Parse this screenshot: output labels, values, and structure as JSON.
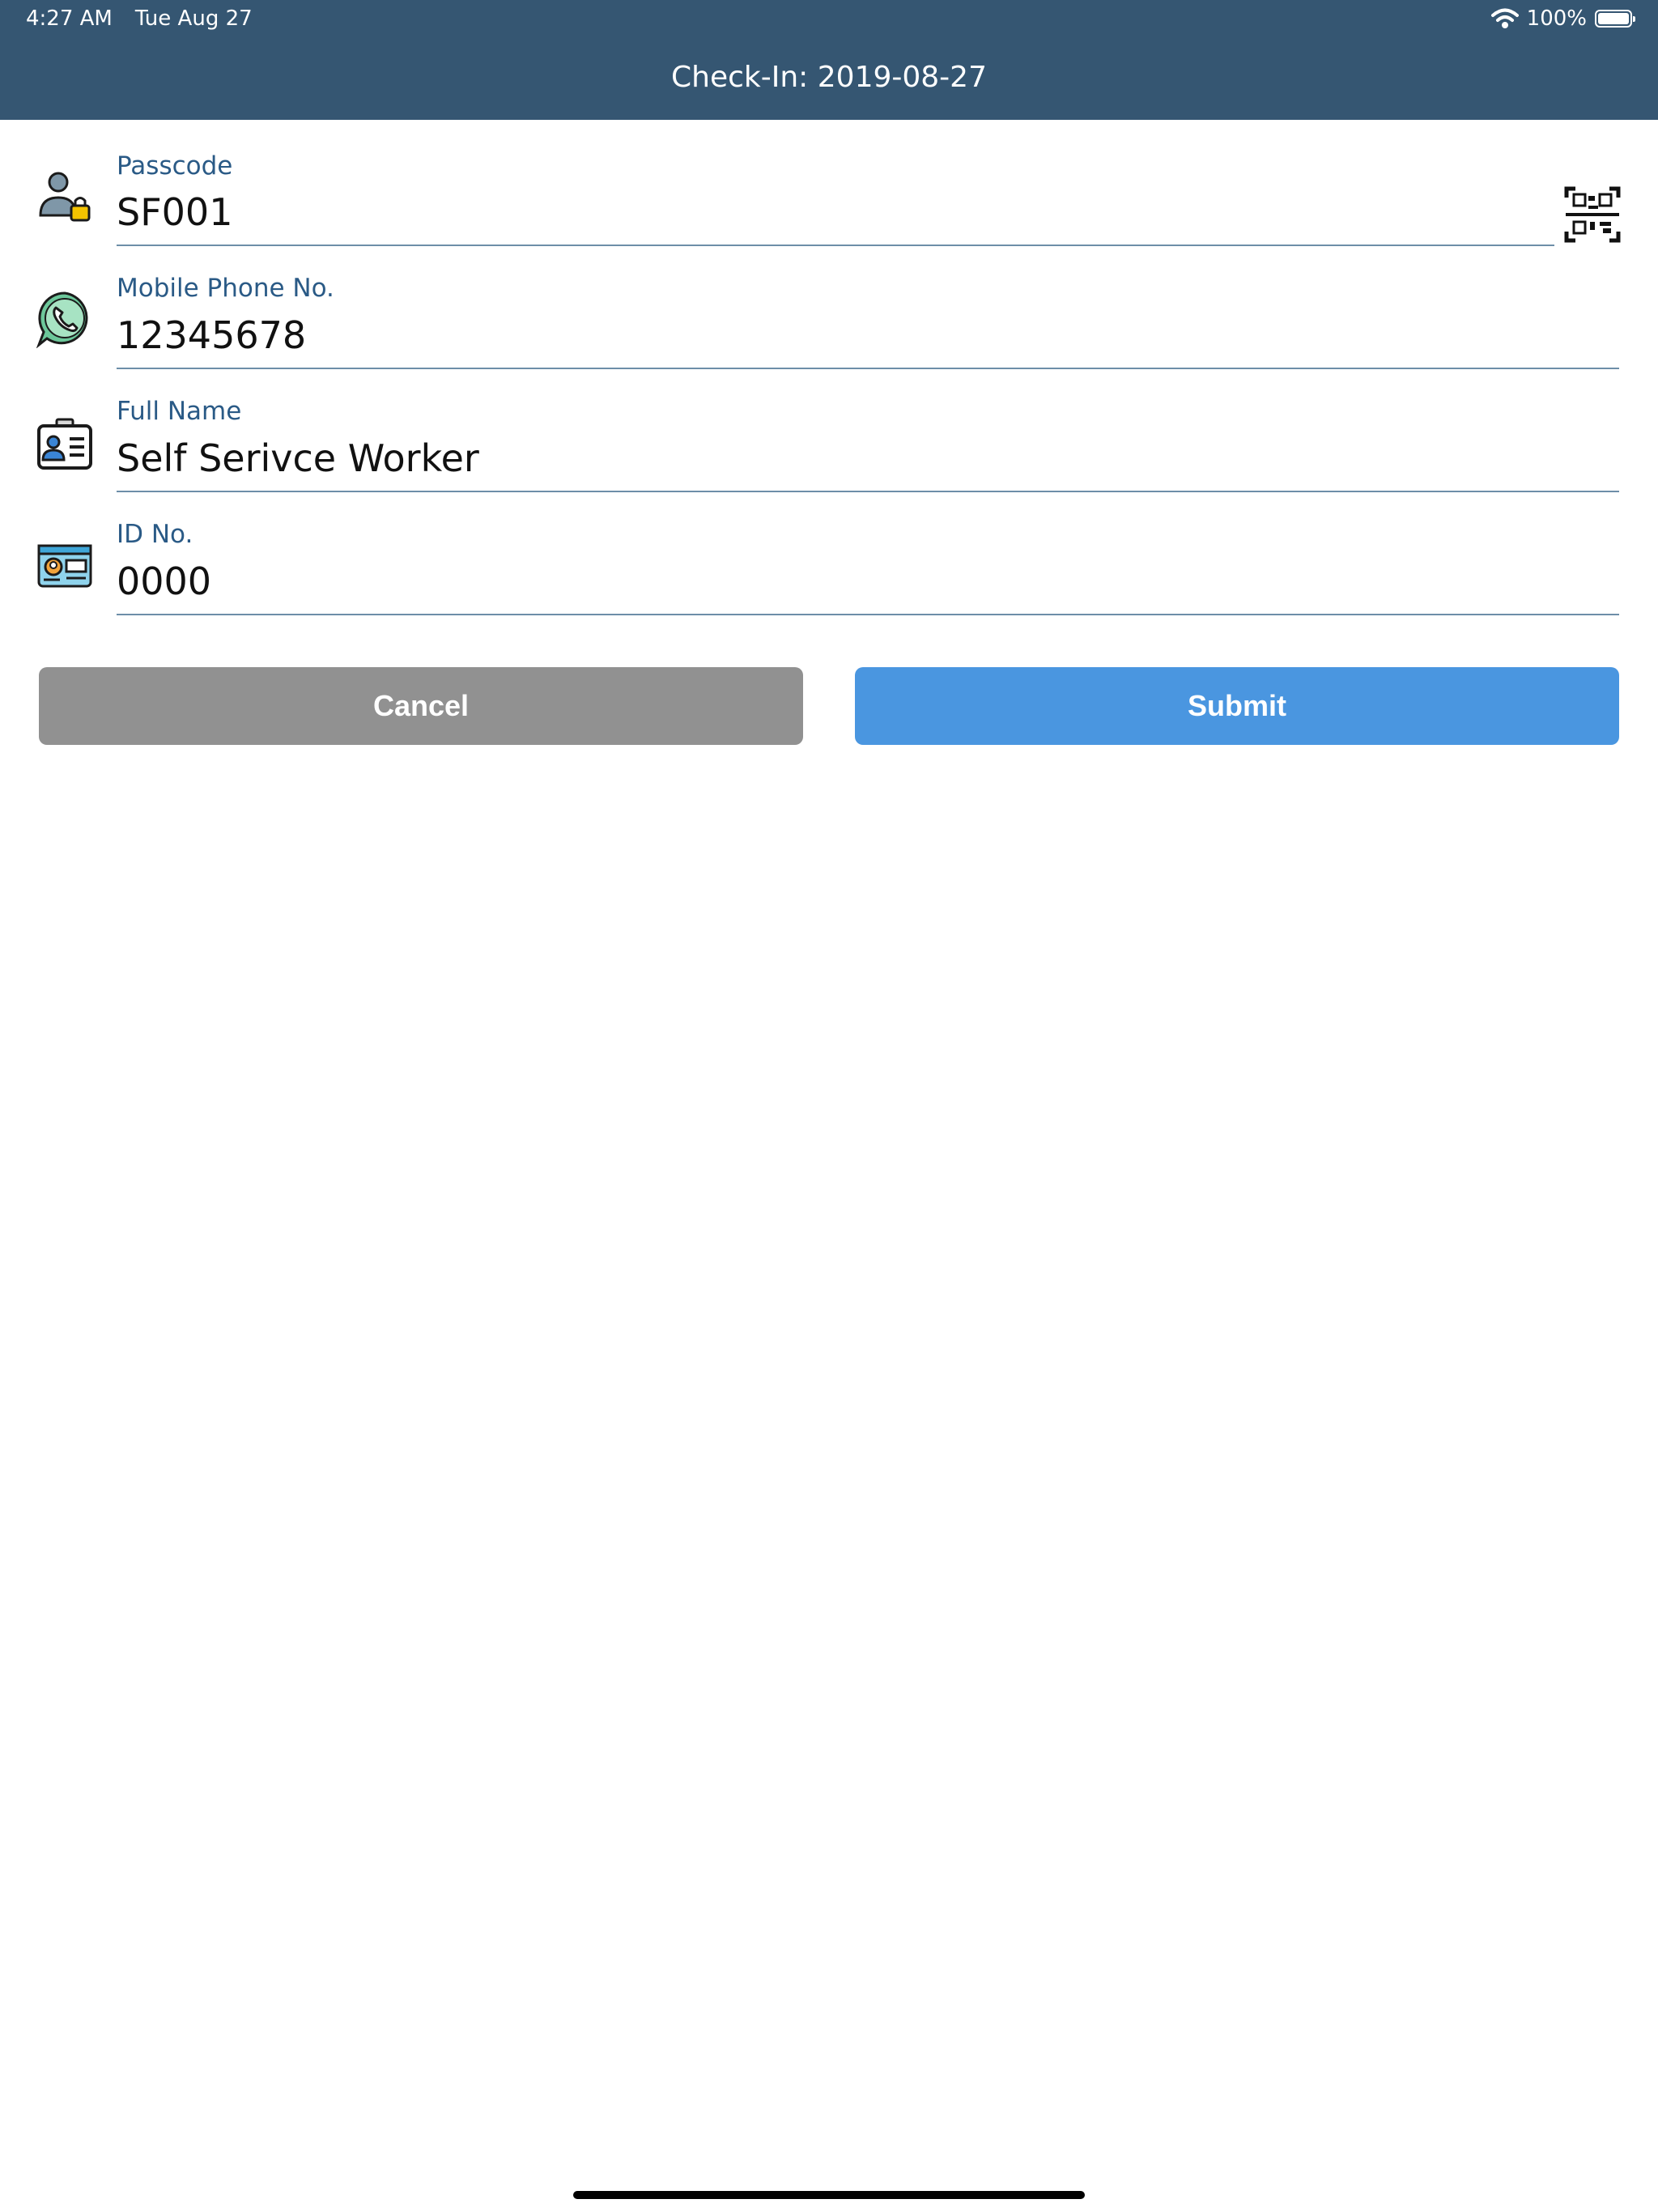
{
  "status_bar": {
    "time": "4:27 AM",
    "date": "Tue Aug 27",
    "battery": "100%",
    "wifi_icon": "wifi-icon",
    "battery_icon": "battery-icon"
  },
  "header": {
    "title": "Check-In: 2019-08-27"
  },
  "form": {
    "fields": [
      {
        "label": "Passcode",
        "value": "SF001",
        "icon": "user-lock-icon"
      },
      {
        "label": "Mobile Phone No.",
        "value": "12345678",
        "icon": "whatsapp-phone-icon"
      },
      {
        "label": "Full Name",
        "value": "Self Serivce Worker",
        "icon": "id-badge-icon"
      },
      {
        "label": "ID No.",
        "value": "0000",
        "icon": "id-card-icon"
      }
    ],
    "qr_icon": "qr-code-icon"
  },
  "actions": {
    "cancel_label": "Cancel",
    "submit_label": "Submit"
  },
  "colors": {
    "header_bg": "#355672",
    "label": "#2a5a86",
    "cancel_bg": "#919191",
    "submit_bg": "#4a96e0"
  }
}
